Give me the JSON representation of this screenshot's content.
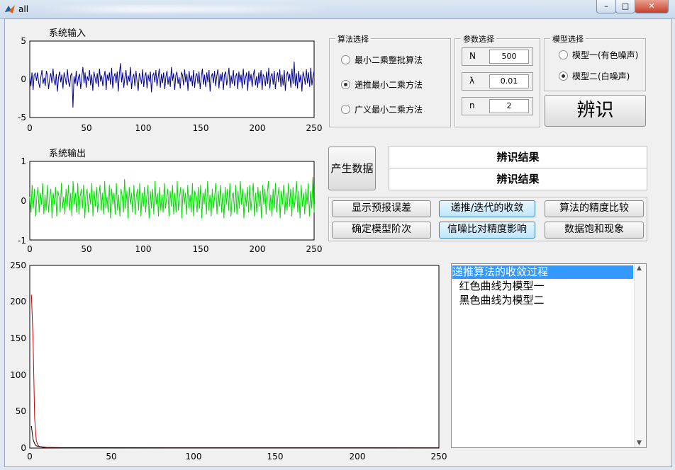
{
  "window": {
    "title": "all"
  },
  "plots": {
    "input": {
      "title": "系统输入",
      "yticks": [
        "5",
        "0",
        "-5"
      ],
      "xticks": [
        "0",
        "50",
        "100",
        "150",
        "200",
        "250"
      ],
      "color": "#00008b",
      "values": [
        0.4,
        -0.9,
        0.9,
        -1.4,
        0.6,
        0.8,
        -0.2,
        0.9,
        -0.4,
        -1.1,
        0.3,
        1.2,
        -0.6,
        0.2,
        -0.9,
        1.1,
        0.5,
        -1.3,
        0.1,
        0.8,
        -0.5,
        1.4,
        -0.2,
        -0.8,
        0.7,
        -1.6,
        0.3,
        1.0,
        -0.4,
        0.6,
        -1.2,
        0.9,
        0.2,
        -0.7,
        1.3,
        -0.3,
        -1.0,
        0.5,
        0.8,
        -3.7,
        0.4,
        -0.6,
        1.1,
        -0.9,
        0.3,
        0.7,
        -1.3,
        0.2,
        1.6,
        -0.5,
        0.9,
        -1.1,
        0.4,
        -0.2,
        1.2,
        -0.8,
        0.6,
        -1.5,
        1.0,
        0.2,
        -0.6,
        0.8,
        -1.0,
        1.4,
        -0.3,
        0.5,
        -0.9,
        0.2,
        1.1,
        -1.4,
        0.6,
        -0.2,
        0.9,
        -0.7,
        1.5,
        -1.2,
        0.3,
        0.8,
        -0.5,
        1.0,
        -1.6,
        0.7,
        2.1,
        -0.4,
        0.9,
        -1.1,
        0.3,
        1.2,
        -0.8,
        0.5,
        -0.3,
        1.6,
        -1.3,
        0.2,
        0.7,
        -0.9,
        1.1,
        -0.4,
        -1.5,
        0.8,
        0.3,
        -0.6,
        1.3,
        -1.0,
        0.4,
        0.9,
        -1.2,
        0.6,
        -0.3,
        1.0,
        -1.7,
        0.5,
        0.8,
        -0.4,
        1.2,
        -0.9,
        0.2,
        1.4,
        -1.1,
        0.7,
        -0.5,
        0.9,
        -1.3,
        0.3,
        1.1,
        -0.7,
        0.4,
        -1.0,
        1.6,
        -0.2,
        0.8,
        -1.4,
        0.5,
        1.0,
        -0.6,
        0.3,
        -1.2,
        0.9,
        0.6,
        -0.8,
        1.3,
        -0.4,
        0.7,
        -1.5,
        1.1,
        -0.3,
        0.5,
        -0.9,
        1.2,
        -1.1,
        0.4,
        0.8,
        -0.6,
        1.0,
        -1.3,
        0.2,
        1.4,
        -0.7,
        0.6,
        -1.0,
        0.9,
        -0.4,
        1.2,
        -1.6,
        0.3,
        0.8,
        -0.5,
        1.1,
        -0.9,
        0.4,
        1.3,
        -1.2,
        0.7,
        -0.3,
        0.9,
        -1.4,
        0.6,
        1.0,
        -0.8,
        0.2,
        1.5,
        -1.1,
        0.5,
        -0.6,
        1.2,
        -0.9,
        0.3,
        0.8,
        -1.3,
        1.0,
        -0.4,
        0.6,
        -1.2,
        1.4,
        -0.7,
        0.2,
        0.9,
        -1.5,
        1.1,
        -0.3,
        0.7,
        -1.0,
        0.5,
        1.3,
        -0.8,
        0.4,
        -1.1,
        0.9,
        -0.5,
        1.2,
        -1.4,
        0.6,
        0.3,
        -0.9,
        1.0,
        -0.6,
        1.5,
        -1.2,
        0.4,
        0.8,
        -0.7,
        1.1,
        -1.3,
        0.2,
        0.9,
        -0.4,
        1.3,
        -1.0,
        0.6,
        -0.8,
        1.2,
        -1.5,
        0.5,
        1.0,
        -0.3,
        0.7,
        -1.1,
        1.4,
        -0.6,
        2.3,
        -0.9,
        0.8,
        -1.2,
        1.1,
        -0.4,
        0.6,
        -1.6,
        1.0,
        0.3,
        -0.7,
        1.3,
        -0.5,
        0.9,
        -1.0,
        1.5,
        -0.8,
        0.4,
        1.1
      ],
      "xlim": [
        0,
        250
      ],
      "ylim": [
        -5,
        5
      ]
    },
    "output": {
      "title": "系统输出",
      "yticks": [
        "1",
        "0",
        "-1"
      ],
      "xticks": [
        "0",
        "50",
        "100",
        "150",
        "200",
        "250"
      ],
      "color": "#00dd00",
      "values": [
        0.1,
        -0.3,
        0.4,
        -0.2,
        0.3,
        -0.4,
        0.1,
        0.35,
        -0.3,
        0.2,
        -0.1,
        0.45,
        -0.35,
        0.15,
        -0.25,
        0.4,
        -0.3,
        0.1,
        0.3,
        -0.45,
        0.2,
        -0.1,
        0.35,
        -0.4,
        0.25,
        0.1,
        -0.3,
        0.45,
        -0.2,
        0.1,
        -0.35,
        0.3,
        -0.15,
        0.4,
        -0.25,
        0.2,
        -0.4,
        0.5,
        -0.1,
        0.2,
        -0.3,
        0.45,
        -0.35,
        0.1,
        0.3,
        -0.2,
        0.4,
        -0.45,
        0.15,
        0.3,
        -0.3,
        0.2,
        -0.1,
        0.45,
        -0.4,
        0.25,
        -0.15,
        0.35,
        -0.3,
        0.1,
        0.4,
        -0.25,
        0.2,
        -0.35,
        0.5,
        -0.2,
        0.1,
        -0.3,
        0.4,
        -0.45,
        0.3,
        -0.1,
        0.2,
        -0.35,
        0.45,
        -0.25,
        0.15,
        -0.4,
        0.3,
        0.1,
        -0.3,
        0.55,
        -0.2,
        0.25,
        -0.45,
        0.35,
        -0.1,
        0.2,
        -0.3,
        0.4,
        -0.35,
        0.1,
        0.3,
        -0.25,
        0.45,
        -0.4,
        0.2,
        -0.15,
        0.35,
        -0.3,
        0.1,
        0.4,
        -0.45,
        0.25,
        -0.2,
        0.3,
        -0.35,
        0.5,
        -0.1,
        0.2,
        -0.4,
        0.35,
        -0.25,
        0.15,
        -0.3,
        0.45,
        -0.2,
        0.1,
        0.3,
        -0.4,
        0.25,
        -0.15,
        0.4,
        -0.35,
        0.2,
        -0.3,
        0.5,
        -0.25,
        0.1,
        0.35,
        -0.45,
        0.3,
        -0.1,
        0.2,
        -0.35,
        0.4,
        -0.2,
        0.15,
        -0.3,
        0.45,
        -0.4,
        0.25,
        0.1,
        -0.3,
        0.35,
        -0.2,
        0.4,
        -0.45,
        0.2,
        -0.1,
        0.3,
        -0.35,
        0.5,
        -0.25,
        0.15,
        -0.4,
        0.3,
        -0.2,
        0.1,
        0.45,
        -0.35,
        0.25,
        -0.15,
        0.4,
        -0.3,
        0.2,
        -0.45,
        0.35,
        -0.1,
        0.3,
        -0.25,
        0.45,
        -0.4,
        0.15,
        0.2,
        -0.3,
        0.4,
        -0.35,
        0.25,
        -0.2,
        0.5,
        -0.1,
        0.3,
        -0.45,
        0.2,
        -0.15,
        0.35,
        -0.3,
        0.4,
        -0.25,
        0.1,
        0.45,
        -0.4,
        0.2,
        -0.3,
        0.35,
        -0.15,
        0.25,
        -0.45,
        0.4,
        -0.1,
        0.3,
        -0.35,
        0.2,
        0.5,
        -0.25,
        0.15,
        -0.4,
        0.3,
        -0.2,
        0.45,
        -0.3,
        0.1,
        0.35,
        -0.45,
        0.25,
        -0.1,
        0.4,
        -0.35,
        0.2,
        -0.25,
        0.45,
        -0.15,
        0.3,
        -0.4,
        0.35,
        -0.2,
        0.1,
        0.5,
        -0.3,
        0.25,
        -0.45,
        0.4,
        -0.15,
        0.2,
        -0.35,
        0.3,
        -0.1,
        0.45,
        -0.4,
        0.25,
        -0.2,
        0.6,
        -0.3
      ],
      "xlim": [
        0,
        250
      ],
      "ylim": [
        -1,
        1
      ]
    },
    "convergence": {
      "yticks": [
        "250",
        "200",
        "150",
        "100",
        "50",
        "0"
      ],
      "xticks": [
        "0",
        "50",
        "100",
        "150",
        "200",
        "250"
      ],
      "xlim": [
        0,
        250
      ],
      "ylim": [
        0,
        250
      ],
      "series": [
        {
          "color": "#cc0000",
          "points": [
            [
              1,
              210
            ],
            [
              2,
              150
            ],
            [
              3,
              40
            ],
            [
              4,
              10
            ],
            [
              5,
              4
            ],
            [
              6,
              2
            ],
            [
              8,
              1
            ],
            [
              10,
              0.5
            ],
            [
              20,
              0.3
            ],
            [
              250,
              0.2
            ]
          ]
        },
        {
          "color": "#000000",
          "points": [
            [
              1,
              30
            ],
            [
              2,
              12
            ],
            [
              3,
              6
            ],
            [
              4,
              3
            ],
            [
              6,
              2
            ],
            [
              8,
              1.5
            ],
            [
              10,
              1
            ],
            [
              20,
              0.5
            ],
            [
              250,
              0.3
            ]
          ]
        }
      ]
    }
  },
  "algo_panel": {
    "title": "算法选择",
    "options": [
      {
        "label": "最小二乘整批算法",
        "selected": false
      },
      {
        "label": "递推最小二乘方法",
        "selected": true
      },
      {
        "label": "广义最小二乘方法",
        "selected": false
      }
    ]
  },
  "param_panel": {
    "title": "参数选择",
    "params": [
      {
        "symbol": "N",
        "value": "500"
      },
      {
        "symbol": "λ",
        "value": "0.01"
      },
      {
        "symbol": "n",
        "value": "2"
      }
    ]
  },
  "model_panel": {
    "title": "模型选择",
    "options": [
      {
        "label": "模型一(有色噪声)",
        "selected": false
      },
      {
        "label": "模型二(白噪声)",
        "selected": true
      }
    ]
  },
  "buttons": {
    "identify": "辨识",
    "generate": "产生数据",
    "show_error": "显示预报误差",
    "convergence": "递推/迭代的收敛",
    "accuracy_compare": "算法的精度比较",
    "model_order": "确定模型阶次",
    "snr_effect": "信噪比对精度影响",
    "saturation": "数据饱和现象"
  },
  "results": {
    "line1": "辨识结果",
    "line2": "辨识结果"
  },
  "listbox": {
    "items": [
      "递推算法的收敛过程",
      "  红色曲线为模型一",
      "  黑色曲线为模型二"
    ],
    "selected_index": 0
  }
}
